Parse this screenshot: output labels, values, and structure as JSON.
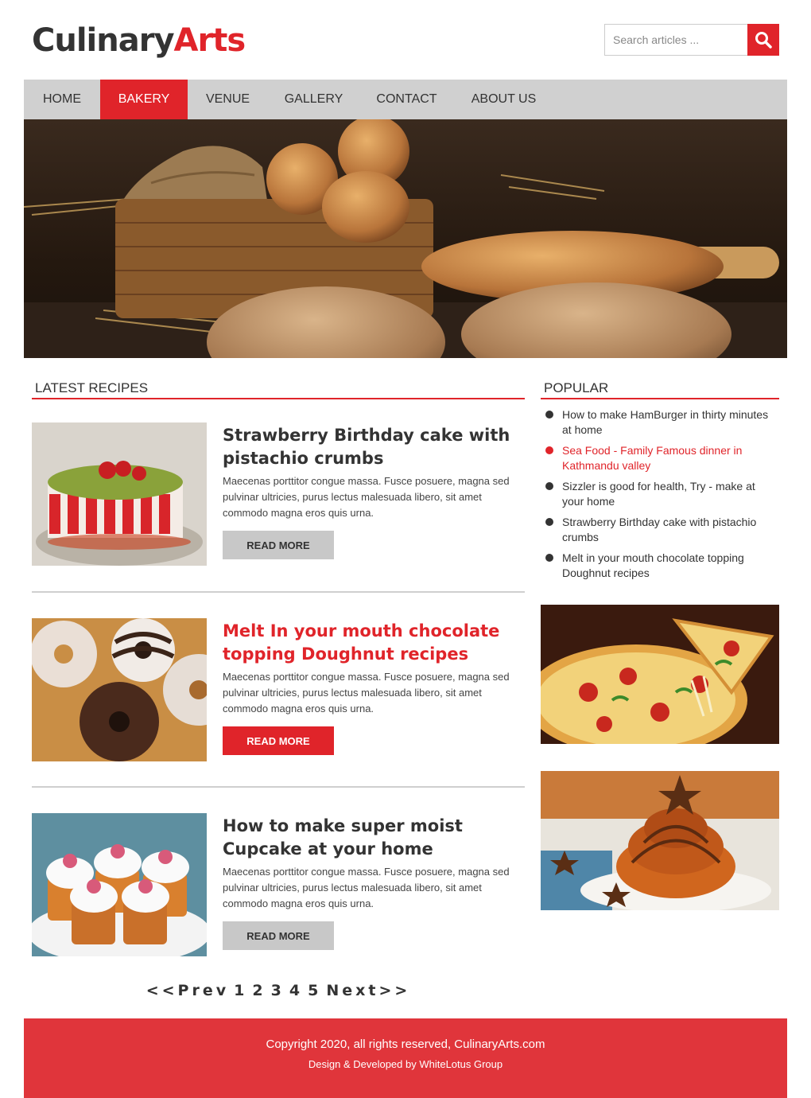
{
  "brand": {
    "part1": "Culinary",
    "part2": "Arts"
  },
  "search": {
    "placeholder": "Search articles ...",
    "icon": "search-icon"
  },
  "nav": {
    "items": [
      {
        "label": "HOME"
      },
      {
        "label": "BAKERY",
        "active": true
      },
      {
        "label": "VENUE"
      },
      {
        "label": "GALLERY"
      },
      {
        "label": "CONTACT"
      },
      {
        "label": "ABOUT US"
      }
    ]
  },
  "hero": {
    "image": "bread-basket-photo"
  },
  "latest": {
    "heading": "LATEST RECIPES",
    "recipes": [
      {
        "title": "Strawberry Birthday cake with pistachio crumbs",
        "desc": "Maecenas porttitor congue massa. Fusce posuere, magna sed pulvinar ultricies, purus lectus malesuada libero, sit amet commodo magna eros quis urna.",
        "button": "READ MORE",
        "image": "strawberry-cake-photo"
      },
      {
        "title": "Melt In your mouth chocolate topping Doughnut recipes",
        "desc": "Maecenas porttitor congue massa. Fusce posuere, magna sed pulvinar ultricies, purus lectus malesuada libero, sit amet commodo magna eros quis urna.",
        "button": "READ MORE",
        "image": "doughnuts-photo"
      },
      {
        "title": "How to make super moist Cupcake at your home",
        "desc": "Maecenas porttitor congue massa. Fusce posuere, magna sed pulvinar ultricies, purus lectus malesuada libero, sit amet commodo magna eros quis urna.",
        "button": "READ MORE",
        "image": "cupcakes-photo"
      }
    ]
  },
  "popular": {
    "heading": "POPULAR",
    "items": [
      {
        "label": "How to make HamBurger in thirty minutes at home"
      },
      {
        "label": "Sea Food - Family Famous dinner in Kathmandu valley",
        "highlight": true
      },
      {
        "label": "Sizzler is good for health, Try - make at your home"
      },
      {
        "label": "Strawberry Birthday cake with pistachio crumbs"
      },
      {
        "label": "Melt in your mouth chocolate topping Doughnut recipes"
      }
    ],
    "images": [
      "pizza-photo",
      "cinnamon-bun-photo"
    ]
  },
  "pagination": {
    "prev": "<<Prev",
    "pages": [
      "1",
      "2",
      "3",
      "4",
      "5"
    ],
    "next": "Next>>"
  },
  "footer": {
    "copyright": "Copyright 2020, all rights reserved, CulinaryArts.com",
    "credit": "Design & Developed by WhiteLotus Group"
  },
  "colors": {
    "accent": "#e0242a",
    "nav_bg": "#d0d0d0",
    "footer_bg": "#e0353b",
    "text": "#333333"
  }
}
